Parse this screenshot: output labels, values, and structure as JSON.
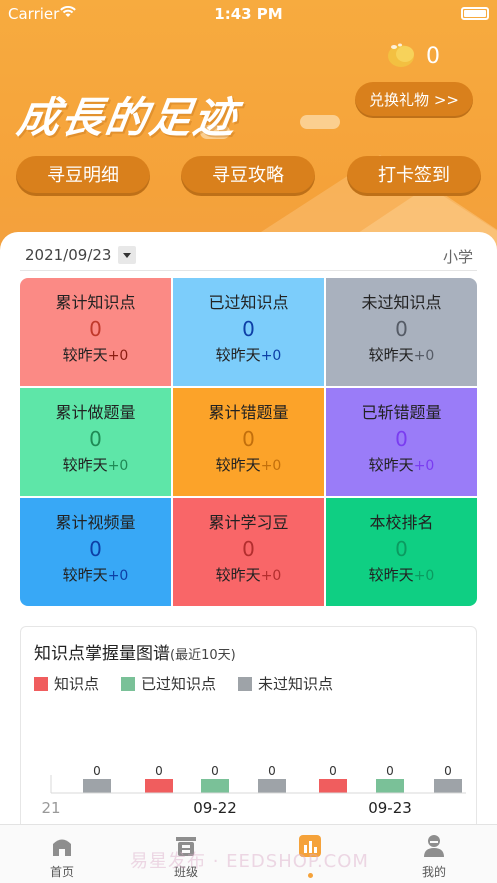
{
  "status": {
    "carrier": "Carrier",
    "time": "1:43 PM"
  },
  "header": {
    "bean_count": "0",
    "brand": "成長的足迹",
    "gift_button": "兑换礼物 >>",
    "pills": [
      "寻豆明细",
      "寻豆攻略",
      "打卡签到"
    ]
  },
  "card": {
    "date": "2021/09/23",
    "level": "小学",
    "stats": [
      {
        "title": "累计知识点",
        "value": "0",
        "delta_prefix": "较昨天",
        "delta": "+0",
        "bg": "#fb8a85",
        "vcolor": "#c0392b",
        "dcolor": "#8b1d12"
      },
      {
        "title": "已过知识点",
        "value": "0",
        "delta_prefix": "较昨天",
        "delta": "+0",
        "bg": "#7ccdfb",
        "vcolor": "#0d3fa6",
        "dcolor": "#0d3fa6"
      },
      {
        "title": "未过知识点",
        "value": "0",
        "delta_prefix": "较昨天",
        "delta": "+0",
        "bg": "#a9b1be",
        "vcolor": "#555b66",
        "dcolor": "#555b66"
      },
      {
        "title": "累计做题量",
        "value": "0",
        "delta_prefix": "较昨天",
        "delta": "+0",
        "bg": "#5ee6a8",
        "vcolor": "#1f8a55",
        "dcolor": "#1f8a55"
      },
      {
        "title": "累计错题量",
        "value": "0",
        "delta_prefix": "较昨天",
        "delta": "+0",
        "bg": "#fca329",
        "vcolor": "#c26f0c",
        "dcolor": "#c26f0c"
      },
      {
        "title": "已斩错题量",
        "value": "0",
        "delta_prefix": "较昨天",
        "delta": "+0",
        "bg": "#9a7cf8",
        "vcolor": "#7a3cf0",
        "dcolor": "#7a3cf0"
      },
      {
        "title": "累计视频量",
        "value": "0",
        "delta_prefix": "较昨天",
        "delta": "+0",
        "bg": "#38a8f6",
        "vcolor": "#0d3fa6",
        "dcolor": "#0d3fa6"
      },
      {
        "title": "累计学习豆",
        "value": "0",
        "delta_prefix": "较昨天",
        "delta": "+0",
        "bg": "#f96668",
        "vcolor": "#b32e2e",
        "dcolor": "#b32e2e"
      },
      {
        "title": "本校排名",
        "value": "0",
        "delta_prefix": "较昨天",
        "delta": "+0",
        "bg": "#0fcf83",
        "vcolor": "#0b9a60",
        "dcolor": "#0b9a60"
      }
    ]
  },
  "panel": {
    "title": "知识点掌握量图谱",
    "subtitle": "(最近10天)",
    "legend": [
      {
        "label": "知识点",
        "color": "#f05d5e"
      },
      {
        "label": "已过知识点",
        "color": "#7ac198"
      },
      {
        "label": "未过知识点",
        "color": "#9ea3a8"
      }
    ]
  },
  "chart_data": {
    "type": "bar",
    "title": "知识点掌握量图谱",
    "subtitle": "(最近10天)",
    "categories": [
      "21",
      "09-22",
      "09-23"
    ],
    "series": [
      {
        "name": "知识点",
        "color": "#f05d5e",
        "values": [
          0,
          0,
          0
        ]
      },
      {
        "name": "已过知识点",
        "color": "#7ac198",
        "values": [
          0,
          0,
          0
        ]
      },
      {
        "name": "未过知识点",
        "color": "#9ea3a8",
        "values": [
          0,
          0,
          0
        ]
      }
    ],
    "bar_labels": [
      "0",
      "0",
      "0",
      "0",
      "0",
      "0",
      "0"
    ],
    "legend_position": "top-left"
  },
  "tabbar": {
    "tabs": [
      {
        "label": "首页"
      },
      {
        "label": "班级"
      },
      {
        "label": ""
      },
      {
        "label": "我的"
      }
    ],
    "watermark": "易星发布 · EEDSHOP.COM"
  }
}
